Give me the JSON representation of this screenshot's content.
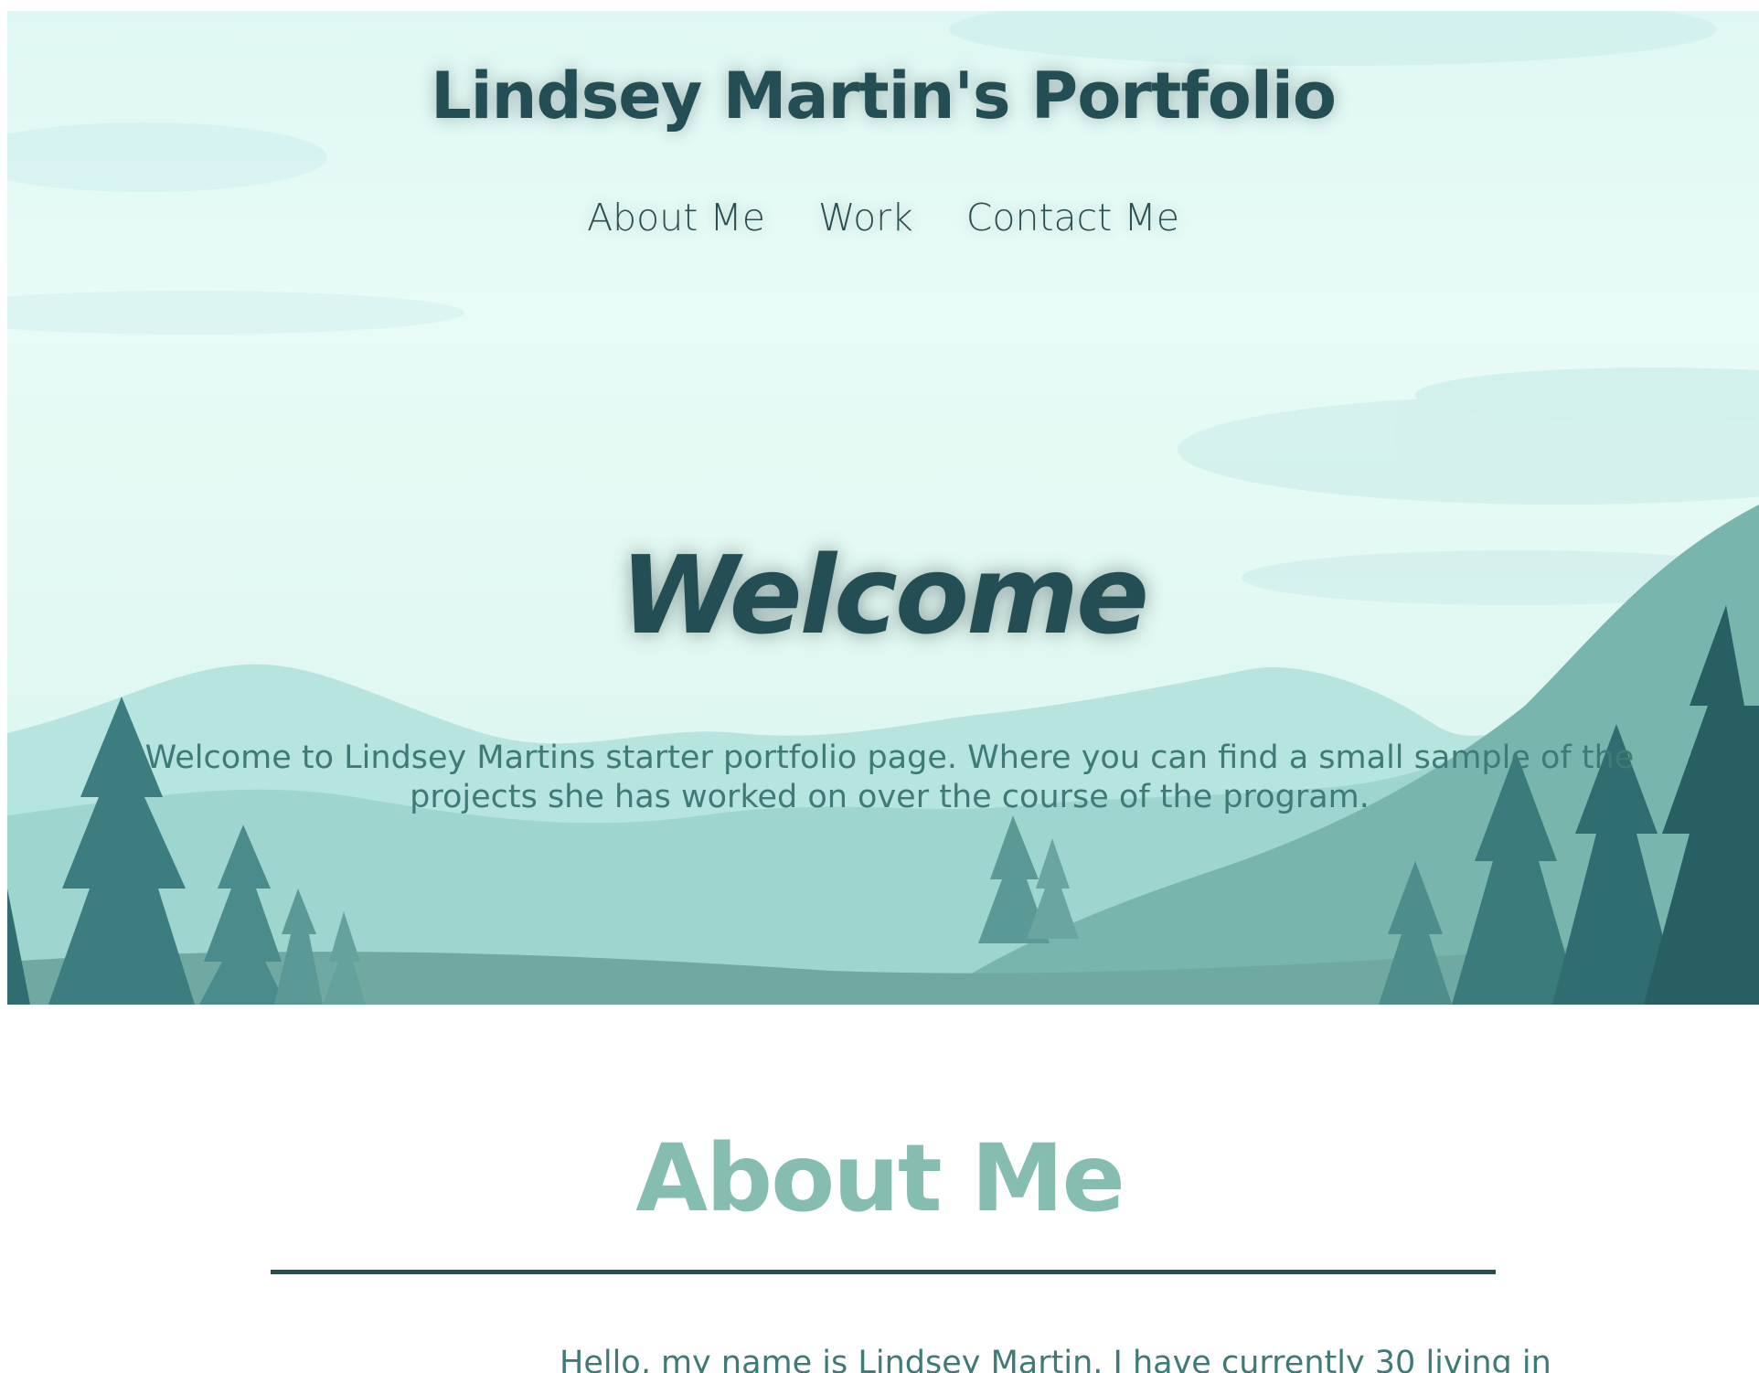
{
  "header": {
    "title": "Lindsey Martin's Portfolio",
    "nav": [
      {
        "label": "About Me"
      },
      {
        "label": "Work"
      },
      {
        "label": "Contact Me"
      }
    ]
  },
  "hero": {
    "heading": "Welcome",
    "text": "Welcome to Lindsey Martins starter portfolio page. Where you can find a small sample of the projects she has worked on over the course of the program."
  },
  "about": {
    "heading": "About Me",
    "text": "Hello, my name is Lindsey Martin. I have currently 30 living in"
  },
  "colors": {
    "dark_teal": "#234f54",
    "mid_teal": "#3f7a76",
    "light_teal": "#86bdb1",
    "sky": "#e4f9f3"
  }
}
